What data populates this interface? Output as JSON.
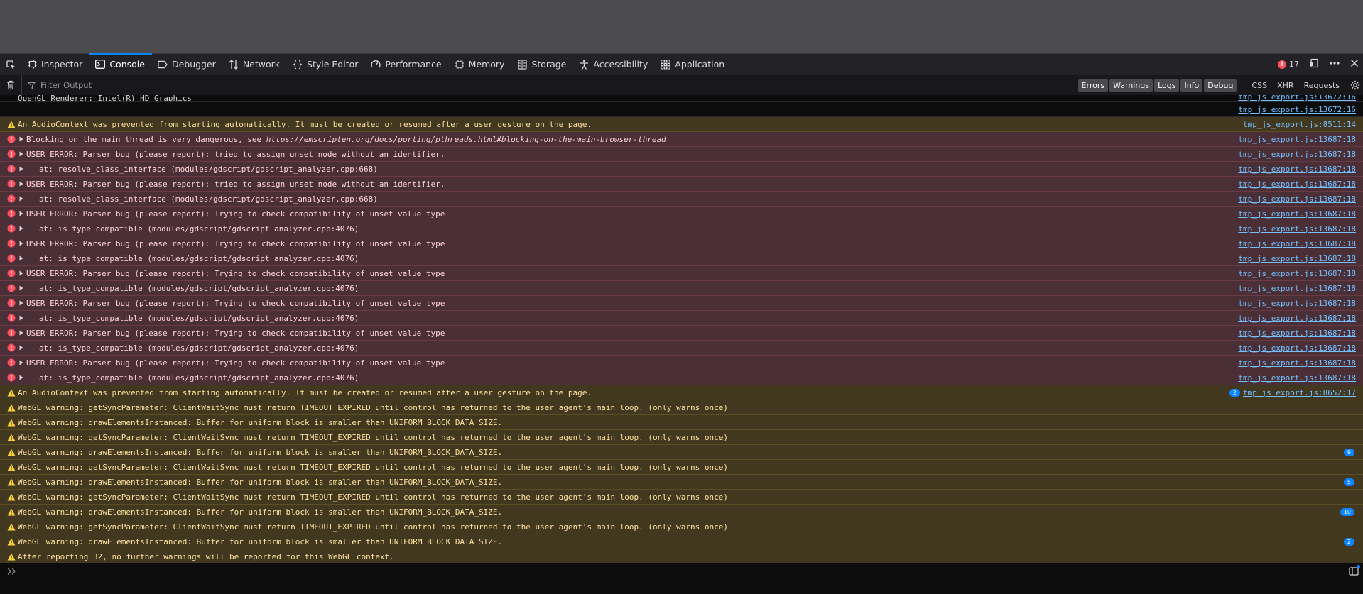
{
  "toolbar": {
    "tabs": [
      {
        "label": "Inspector",
        "icon": "inspector-icon"
      },
      {
        "label": "Console",
        "icon": "console-icon",
        "active": true
      },
      {
        "label": "Debugger",
        "icon": "debugger-icon"
      },
      {
        "label": "Network",
        "icon": "network-icon"
      },
      {
        "label": "Style Editor",
        "icon": "style-editor-icon"
      },
      {
        "label": "Performance",
        "icon": "performance-icon"
      },
      {
        "label": "Memory",
        "icon": "memory-icon"
      },
      {
        "label": "Storage",
        "icon": "storage-icon"
      },
      {
        "label": "Accessibility",
        "icon": "accessibility-icon"
      },
      {
        "label": "Application",
        "icon": "application-icon"
      }
    ],
    "error_count": "17"
  },
  "filterbar": {
    "placeholder": "Filter Output",
    "levels": [
      "Errors",
      "Warnings",
      "Logs",
      "Info",
      "Debug"
    ],
    "requests": [
      "CSS",
      "XHR",
      "Requests"
    ]
  },
  "log": {
    "partial_top": {
      "msg": "OpenGL Renderer: Intel(R) HD Graphics",
      "src": "tmp_js_export.js:13672:16"
    },
    "rows": [
      {
        "type": "log",
        "msg": "",
        "src": "tmp_js_export.js:13672:16"
      },
      {
        "type": "warn",
        "msg": "An AudioContext was prevented from starting automatically. It must be created or resumed after a user gesture on the page.",
        "src": "tmp_js_export.js:8511:14"
      },
      {
        "type": "err",
        "msg": "Blocking on the main thread is very dangerous, see ",
        "link": "https://emscripten.org/docs/porting/pthreads.html#blocking-on-the-main-browser-thread",
        "src": "tmp_js_export.js:13687:18"
      },
      {
        "type": "err",
        "msg": "USER ERROR: Parser bug (please report): tried to assign unset node without an identifier.",
        "src": "tmp_js_export.js:13687:18"
      },
      {
        "type": "err",
        "indent": true,
        "msg": "at: resolve_class_interface (modules/gdscript/gdscript_analyzer.cpp:668)",
        "src": "tmp_js_export.js:13687:18"
      },
      {
        "type": "err",
        "msg": "USER ERROR: Parser bug (please report): tried to assign unset node without an identifier.",
        "src": "tmp_js_export.js:13687:18"
      },
      {
        "type": "err",
        "indent": true,
        "msg": "at: resolve_class_interface (modules/gdscript/gdscript_analyzer.cpp:668)",
        "src": "tmp_js_export.js:13687:18"
      },
      {
        "type": "err",
        "msg": "USER ERROR: Parser bug (please report): Trying to check compatibility of unset value type",
        "src": "tmp_js_export.js:13687:18"
      },
      {
        "type": "err",
        "indent": true,
        "msg": "at: is_type_compatible (modules/gdscript/gdscript_analyzer.cpp:4076)",
        "src": "tmp_js_export.js:13687:18"
      },
      {
        "type": "err",
        "msg": "USER ERROR: Parser bug (please report): Trying to check compatibility of unset value type",
        "src": "tmp_js_export.js:13687:18"
      },
      {
        "type": "err",
        "indent": true,
        "msg": "at: is_type_compatible (modules/gdscript/gdscript_analyzer.cpp:4076)",
        "src": "tmp_js_export.js:13687:18"
      },
      {
        "type": "err",
        "msg": "USER ERROR: Parser bug (please report): Trying to check compatibility of unset value type",
        "src": "tmp_js_export.js:13687:18"
      },
      {
        "type": "err",
        "indent": true,
        "msg": "at: is_type_compatible (modules/gdscript/gdscript_analyzer.cpp:4076)",
        "src": "tmp_js_export.js:13687:18"
      },
      {
        "type": "err",
        "msg": "USER ERROR: Parser bug (please report): Trying to check compatibility of unset value type",
        "src": "tmp_js_export.js:13687:18"
      },
      {
        "type": "err",
        "indent": true,
        "msg": "at: is_type_compatible (modules/gdscript/gdscript_analyzer.cpp:4076)",
        "src": "tmp_js_export.js:13687:18"
      },
      {
        "type": "err",
        "msg": "USER ERROR: Parser bug (please report): Trying to check compatibility of unset value type",
        "src": "tmp_js_export.js:13687:18"
      },
      {
        "type": "err",
        "indent": true,
        "msg": "at: is_type_compatible (modules/gdscript/gdscript_analyzer.cpp:4076)",
        "src": "tmp_js_export.js:13687:18"
      },
      {
        "type": "err",
        "msg": "USER ERROR: Parser bug (please report): Trying to check compatibility of unset value type",
        "src": "tmp_js_export.js:13687:18"
      },
      {
        "type": "err",
        "indent": true,
        "msg": "at: is_type_compatible (modules/gdscript/gdscript_analyzer.cpp:4076)",
        "src": "tmp_js_export.js:13687:18"
      },
      {
        "type": "warn",
        "msg": "An AudioContext was prevented from starting automatically. It must be created or resumed after a user gesture on the page.",
        "src": "tmp_js_export.js:8652:17",
        "badge": "2"
      },
      {
        "type": "warn",
        "msg": "WebGL warning: getSyncParameter: ClientWaitSync must return TIMEOUT_EXPIRED until control has returned to the user agent's main loop. (only warns once)"
      },
      {
        "type": "warn",
        "msg": "WebGL warning: drawElementsInstanced: Buffer for uniform block is smaller than UNIFORM_BLOCK_DATA_SIZE."
      },
      {
        "type": "warn",
        "msg": "WebGL warning: getSyncParameter: ClientWaitSync must return TIMEOUT_EXPIRED until control has returned to the user agent's main loop. (only warns once)"
      },
      {
        "type": "warn",
        "msg": "WebGL warning: drawElementsInstanced: Buffer for uniform block is smaller than UNIFORM_BLOCK_DATA_SIZE.",
        "badge": "9"
      },
      {
        "type": "warn",
        "msg": "WebGL warning: getSyncParameter: ClientWaitSync must return TIMEOUT_EXPIRED until control has returned to the user agent's main loop. (only warns once)"
      },
      {
        "type": "warn",
        "msg": "WebGL warning: drawElementsInstanced: Buffer for uniform block is smaller than UNIFORM_BLOCK_DATA_SIZE.",
        "badge": "5"
      },
      {
        "type": "warn",
        "msg": "WebGL warning: getSyncParameter: ClientWaitSync must return TIMEOUT_EXPIRED until control has returned to the user agent's main loop. (only warns once)"
      },
      {
        "type": "warn",
        "msg": "WebGL warning: drawElementsInstanced: Buffer for uniform block is smaller than UNIFORM_BLOCK_DATA_SIZE.",
        "badge": "10"
      },
      {
        "type": "warn",
        "msg": "WebGL warning: getSyncParameter: ClientWaitSync must return TIMEOUT_EXPIRED until control has returned to the user agent's main loop. (only warns once)"
      },
      {
        "type": "warn",
        "msg": "WebGL warning: drawElementsInstanced: Buffer for uniform block is smaller than UNIFORM_BLOCK_DATA_SIZE.",
        "badge": "2"
      },
      {
        "type": "warn",
        "msg": "After reporting 32, no further warnings will be reported for this WebGL context."
      }
    ]
  },
  "colors": {
    "accent": "#0a84ff",
    "error_bg": "#4a2f37",
    "warn_bg": "#42381f",
    "error_icon": "#ff4f5e",
    "warn_icon": "#ffd43b",
    "link": "#75bfff"
  }
}
